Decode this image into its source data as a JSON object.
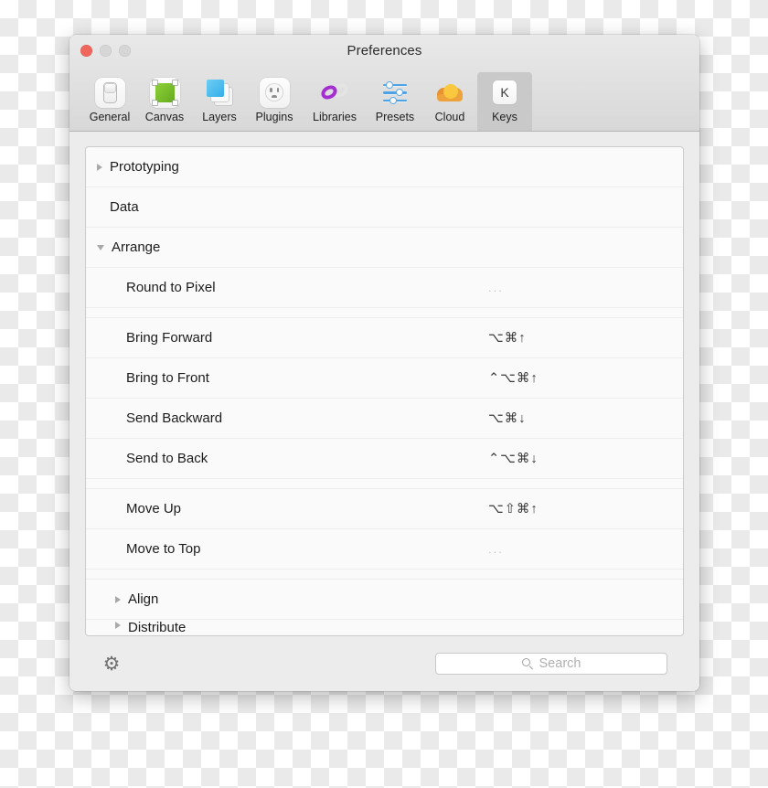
{
  "window": {
    "title": "Preferences",
    "traffic_lights": [
      {
        "name": "close",
        "color": "#f1665c"
      },
      {
        "name": "minimize",
        "color": "#d6d6d6"
      },
      {
        "name": "zoom",
        "color": "#d6d6d6"
      }
    ]
  },
  "toolbar": {
    "tabs": [
      {
        "label": "General",
        "icon": "toggle-switch-icon",
        "selected": false
      },
      {
        "label": "Canvas",
        "icon": "green-square-icon",
        "selected": false
      },
      {
        "label": "Layers",
        "icon": "stacked-layers-icon",
        "selected": false
      },
      {
        "label": "Plugins",
        "icon": "power-outlet-icon",
        "selected": false
      },
      {
        "label": "Libraries",
        "icon": "linked-rings-icon",
        "selected": false
      },
      {
        "label": "Presets",
        "icon": "sliders-icon",
        "selected": false
      },
      {
        "label": "Cloud",
        "icon": "cloud-icon",
        "selected": false
      },
      {
        "label": "Keys",
        "icon": "keycap-k-icon",
        "selected": true
      }
    ],
    "selected_tab": "Keys"
  },
  "shortcut_list": {
    "rows": [
      {
        "label": "Prototyping",
        "level": 0,
        "disclosure": "collapsed",
        "shortcut": ""
      },
      {
        "label": "Data",
        "level": 0,
        "disclosure": "none",
        "shortcut": ""
      },
      {
        "label": "Arrange",
        "level": 0,
        "disclosure": "expanded",
        "shortcut": ""
      },
      {
        "label": "Round to Pixel",
        "level": 1,
        "disclosure": "none",
        "shortcut": "..."
      },
      {
        "label": "Bring Forward",
        "level": 1,
        "disclosure": "none",
        "shortcut": "⌥⌘↑"
      },
      {
        "label": "Bring to Front",
        "level": 1,
        "disclosure": "none",
        "shortcut": "⌃⌥⌘↑"
      },
      {
        "label": "Send Backward",
        "level": 1,
        "disclosure": "none",
        "shortcut": "⌥⌘↓"
      },
      {
        "label": "Send to Back",
        "level": 1,
        "disclosure": "none",
        "shortcut": "⌃⌥⌘↓"
      },
      {
        "label": "Move Up",
        "level": 1,
        "disclosure": "none",
        "shortcut": "⌥⇧⌘↑"
      },
      {
        "label": "Move to Top",
        "level": 1,
        "disclosure": "none",
        "shortcut": "..."
      },
      {
        "label": "Align",
        "level": 1,
        "disclosure": "collapsed",
        "shortcut": ""
      },
      {
        "label": "Distribute",
        "level": 1,
        "disclosure": "collapsed",
        "shortcut": "",
        "clipped": true
      }
    ]
  },
  "footer": {
    "gear_icon": "gear-icon",
    "search": {
      "icon": "search-icon",
      "placeholder": "Search",
      "value": ""
    }
  },
  "colors": {
    "window_chrome": "#e9e9e9",
    "list_background": "#fafafa",
    "selected_tab_background": "#c9c9c9",
    "close_button": "#f1665c",
    "canvas_green": "#7ec12b",
    "layers_blue": "#33aee8",
    "libraries_purple": "#a42fd0",
    "cloud_yellow": "#f9c83f",
    "presets_blue": "#4da3e8"
  }
}
